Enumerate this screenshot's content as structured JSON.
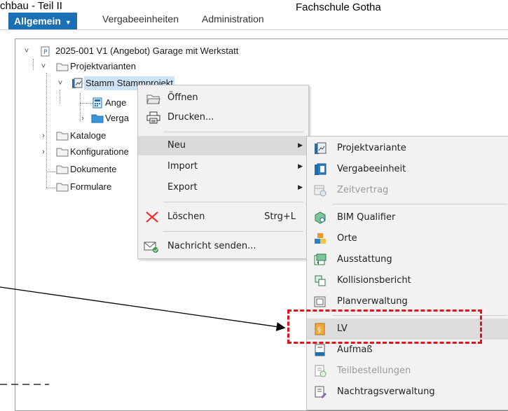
{
  "header": {
    "left_text": "chbau - Teil II",
    "right_text": "Fachschule Gotha"
  },
  "tabs": [
    {
      "label": "Allgemein"
    },
    {
      "label": "Vergabeeinheiten"
    },
    {
      "label": "Administration"
    }
  ],
  "tree": {
    "root": "2025-001 V1 (Angebot) Garage mit Werkstatt",
    "projektvarianten": "Projektvarianten",
    "stamm": "Stamm Stammprojekt",
    "angebot": "Ange",
    "verga": "Verga",
    "kataloge": "Kataloge",
    "konfigurationen": "Konfiguratione",
    "dokumente": "Dokumente",
    "formulare": "Formulare"
  },
  "context_menu": {
    "open": "Öffnen",
    "print": "Drucken...",
    "new": "Neu",
    "import": "Import",
    "export": "Export",
    "delete": "Löschen",
    "delete_shortcut": "Strg+L",
    "send_message": "Nachricht senden..."
  },
  "submenu": {
    "projektvariante": "Projektvariante",
    "vergabeeinheit": "Vergabeeinheit",
    "zeitvertrag": "Zeitvertrag",
    "bim_qualifier": "BIM Qualifier",
    "orte": "Orte",
    "ausstattung": "Ausstattung",
    "kollisionsbericht": "Kollisionsbericht",
    "planverwaltung": "Planverwaltung",
    "lv": "LV",
    "aufmass": "Aufmaß",
    "teilbestellungen": "Teilbestellungen",
    "nachtragsverwaltung": "Nachtragsverwaltung"
  },
  "colors": {
    "accent": "#1a6fb5",
    "highlight_red": "#e0141c"
  }
}
